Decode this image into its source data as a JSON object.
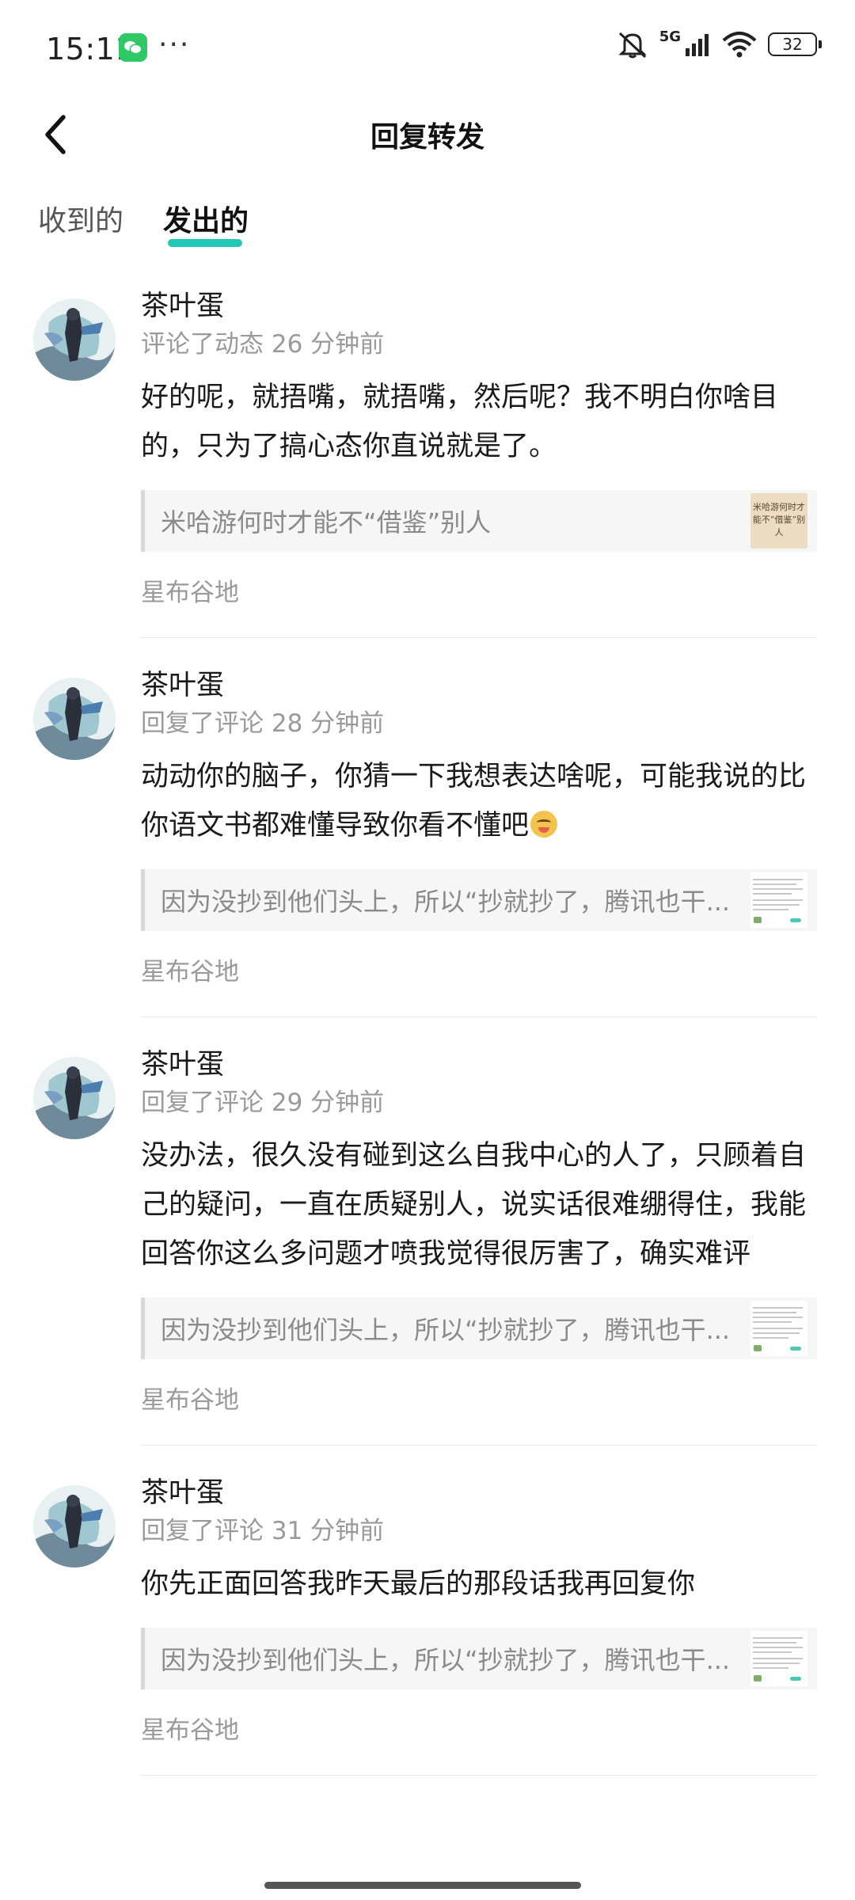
{
  "status_bar": {
    "time": "15:11",
    "network": "5G",
    "battery": "32",
    "icons": [
      "wechat-icon",
      "more-dots-icon",
      "mute-icon",
      "signal-icon",
      "wifi-icon",
      "battery-icon"
    ]
  },
  "nav": {
    "title": "回复转发",
    "back_icon": "chevron-left-icon"
  },
  "tabs": [
    {
      "label": "收到的",
      "active": false
    },
    {
      "label": "发出的",
      "active": true
    }
  ],
  "accent_color": "#23c7b5",
  "items": [
    {
      "user": "茶叶蛋",
      "action": "评论了动态 26 分钟前",
      "content": "好的呢，就捂嘴，就捂嘴，然后呢？我不明白你啥目的，只为了搞心态你直说就是了。",
      "quote": "米哈游何时才能不“借鉴”别人",
      "thumb_text": "米哈游何时才能不“借鉴”别人",
      "topic": "星布谷地"
    },
    {
      "user": "茶叶蛋",
      "action": "回复了评论 28 分钟前",
      "content": "动动你的脑子，你猜一下我想表达啥呢，可能我说的比你语文书都难懂导致你看不懂吧",
      "emoji": "laughing-emoji",
      "quote": "因为没抄到他们头上，所以“抄就抄了，腾讯也干...",
      "topic": "星布谷地"
    },
    {
      "user": "茶叶蛋",
      "action": "回复了评论 29 分钟前",
      "content": "没办法，很久没有碰到这么自我中心的人了，只顾着自己的疑问，一直在质疑别人，说实话很难绷得住，我能回答你这么多问题才喷我觉得很厉害了，确实难评",
      "quote": "因为没抄到他们头上，所以“抄就抄了，腾讯也干...",
      "topic": "星布谷地"
    },
    {
      "user": "茶叶蛋",
      "action": "回复了评论 31 分钟前",
      "content": "你先正面回答我昨天最后的那段话我再回复你",
      "quote": "因为没抄到他们头上，所以“抄就抄了，腾讯也干...",
      "topic": "星布谷地"
    }
  ]
}
